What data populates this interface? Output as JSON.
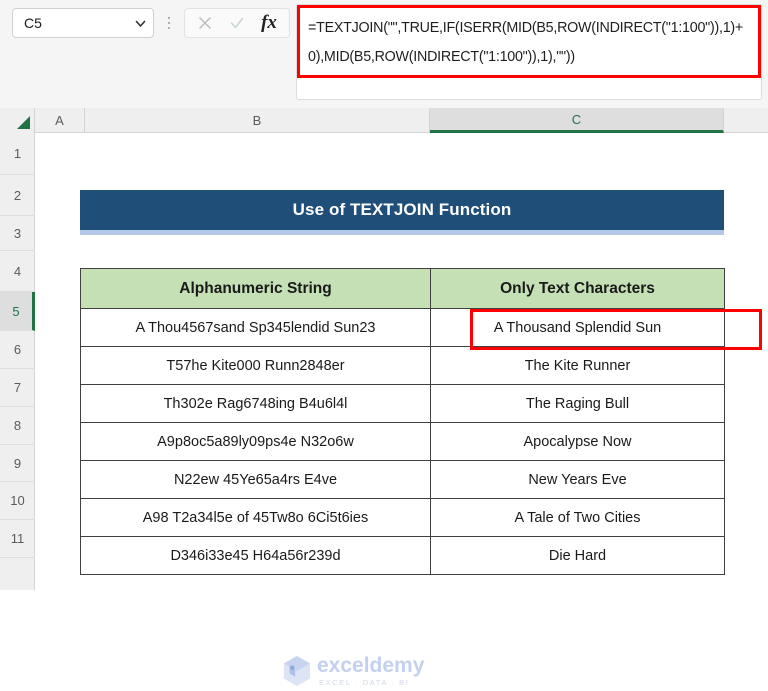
{
  "formula_bar": {
    "name_box_value": "C5",
    "name_box_placeholder": "Name Box",
    "chevron_icon": "chevron-down-icon",
    "more_icon": "more-vertical-icon",
    "cancel_icon": "cancel-x-icon",
    "confirm_icon": "confirm-check-icon",
    "insert_function_icon": "fx-icon",
    "insert_function_label": "fx",
    "formula": "=TEXTJOIN(\"\",TRUE,IF(ISERR(MID(B5,ROW(INDIRECT(\"1:100\")),1)+0),MID(B5,ROW(INDIRECT(\"1:100\")),1),\"\"))",
    "highlight_color": "#ff0000"
  },
  "grid": {
    "select_all_icon": "select-all-triangle-icon",
    "columns": [
      {
        "label": "A",
        "selected": false
      },
      {
        "label": "B",
        "selected": false
      },
      {
        "label": "C",
        "selected": true
      }
    ],
    "rows": [
      {
        "label": "1",
        "selected": false
      },
      {
        "label": "2",
        "selected": false
      },
      {
        "label": "3",
        "selected": false
      },
      {
        "label": "4",
        "selected": false
      },
      {
        "label": "5",
        "selected": true
      },
      {
        "label": "6",
        "selected": false
      },
      {
        "label": "7",
        "selected": false
      },
      {
        "label": "8",
        "selected": false
      },
      {
        "label": "9",
        "selected": false
      },
      {
        "label": "10",
        "selected": false
      },
      {
        "label": "11",
        "selected": false
      }
    ],
    "selected_cell": "C5",
    "header_selected_accent": "#217346"
  },
  "sheet": {
    "title": "Use of TEXTJOIN Function",
    "title_bg": "#1f4e79",
    "title_shadow": "#b4c7e7",
    "table": {
      "header_bg": "#c5e0b4",
      "headers": [
        "Alphanumeric String",
        "Only Text Characters"
      ],
      "rows": [
        {
          "b": "A Thou4567sand Sp345lendid Sun23",
          "c": "A Thousand Splendid Sun"
        },
        {
          "b": "T57he Kite000 Runn2848er",
          "c": "The Kite Runner"
        },
        {
          "b": "Th302e Rag6748ing B4u6l4l",
          "c": "The Raging Bull"
        },
        {
          "b": "A9p8oc5a89ly09ps4e N32o6w",
          "c": "Apocalypse Now"
        },
        {
          "b": "N22ew 45Ye65a4rs E4ve",
          "c": "New Years Eve"
        },
        {
          "b": "A98 T2a34l5e of 45Tw8o 6Ci5t6ies",
          "c": "A Tale of Two Cities"
        },
        {
          "b": "D346i33e45 H64a56r239d",
          "c": "Die Hard"
        }
      ]
    }
  },
  "watermark": {
    "logo_icon": "exceldemy-cube-logo-icon",
    "name": "exceldemy",
    "subtitle": "EXCEL · DATA · BI"
  }
}
